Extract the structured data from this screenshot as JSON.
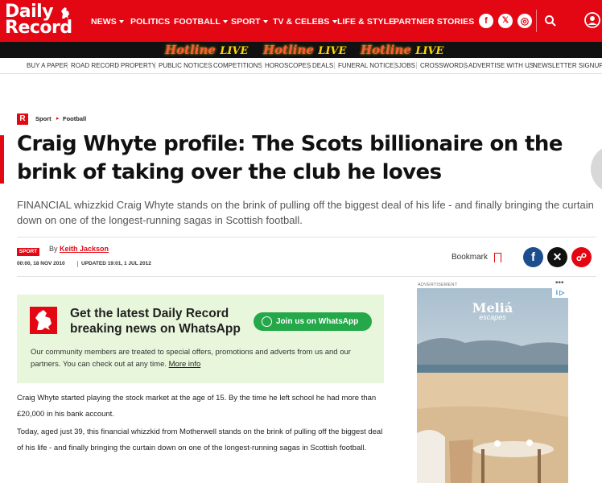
{
  "logo": {
    "line1": "Daily",
    "line2": "Record"
  },
  "nav": {
    "items": [
      {
        "label": "NEWS",
        "dropdown": true
      },
      {
        "label": "POLITICS",
        "dropdown": false
      },
      {
        "label": "FOOTBALL",
        "dropdown": true
      },
      {
        "label": "SPORT",
        "dropdown": true
      },
      {
        "label": "TV & CELEBS",
        "dropdown": true
      },
      {
        "label": "LIFE & STYLE",
        "dropdown": false
      },
      {
        "label": "PARTNER STORIES",
        "dropdown": false
      }
    ],
    "social": {
      "facebook": "f",
      "x": "𝕏",
      "instagram": "◎"
    },
    "brand_color": "#e30613"
  },
  "hotline": {
    "word": "Hotline",
    "live": "LIVE"
  },
  "subnav": [
    "BUY A PAPER",
    "ROAD RECORD",
    "PROPERTY",
    "PUBLIC NOTICES",
    "COMPETITIONS",
    "HOROSCOPES",
    "DEALS",
    "FUNERAL NOTICES",
    "JOBS",
    "CROSSWORDS",
    "ADVERTISE WITH US",
    "NEWSLETTER SIGNUP"
  ],
  "breadcrumb": {
    "badge": "R",
    "section": "Sport",
    "subsection": "Football"
  },
  "article": {
    "headline": "Craig Whyte profile: The Scots billionaire on the brink of taking over the club he loves",
    "standfirst": "FINANCIAL whizzkid Craig Whyte stands on the brink of pulling off the biggest deal of his life - and finally bringing the curtain down on one of the longest-running sagas in Scottish football.",
    "tag": "SPORT",
    "by": "By",
    "author": "Keith Jackson",
    "published": "00:00, 18 NOV 2010",
    "updated": "UPDATED 19:01, 1 JUL 2012",
    "bookmark": "Bookmark",
    "paragraphs": [
      "Craig Whyte started playing the stock market at the age of 15. By the time he left school he had more than £20,000 in his bank account.",
      "Today, aged just 39, this financial whizzkid from Motherwell stands on the brink of pulling off the biggest deal of his life - and finally bringing the curtain down on one of the longest-running sagas in Scottish football."
    ]
  },
  "share": {
    "facebook": "f",
    "x": "✕",
    "link": "☍"
  },
  "whatsapp": {
    "title": "Get the latest Daily Record breaking news on WhatsApp",
    "button": "Join us on WhatsApp",
    "text": "Our community members are treated to special offers, promotions and adverts from us and our partners. You can check out at any time.",
    "more": "More info"
  },
  "ad": {
    "label": "ADVERTISEMENT",
    "brand": "Meliá",
    "brand_sub": "escapes",
    "adchoices": "i ▷"
  }
}
